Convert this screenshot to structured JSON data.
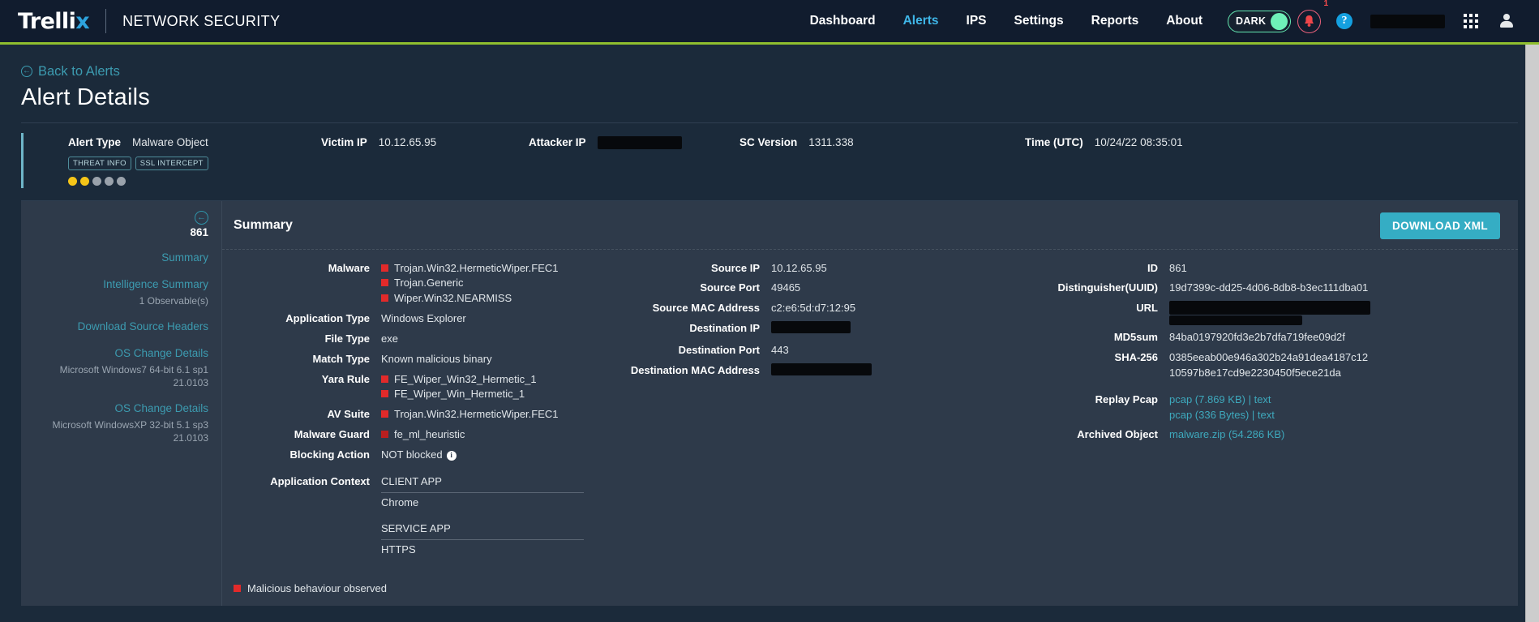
{
  "topnav": {
    "brand": "Trellix",
    "brand_sub": "NETWORK SECURITY",
    "links": [
      {
        "label": "Dashboard",
        "active": false
      },
      {
        "label": "Alerts",
        "active": true
      },
      {
        "label": "IPS",
        "active": false
      },
      {
        "label": "Settings",
        "active": false
      },
      {
        "label": "Reports",
        "active": false
      },
      {
        "label": "About",
        "active": false
      }
    ],
    "theme_toggle": "DARK",
    "notification_badge": "1",
    "help_glyph": "?",
    "accent_color": "#3fb6e8",
    "toggle_color": "#6ff0b8",
    "bar_color": "#8fbe2e"
  },
  "page": {
    "back_link": "Back to Alerts",
    "title": "Alert Details"
  },
  "meta": {
    "alert_type_label": "Alert Type",
    "alert_type_value": "Malware Object",
    "victim_ip_label": "Victim IP",
    "victim_ip_value": "10.12.65.95",
    "attacker_ip_label": "Attacker IP",
    "attacker_ip_value": "",
    "sc_version_label": "SC Version",
    "sc_version_value": "1311.338",
    "time_label": "Time (UTC)",
    "time_value": "10/24/22 08:35:01",
    "tags": [
      "THREAT INFO",
      "SSL INTERCEPT"
    ],
    "severity_filled": 2,
    "severity_total": 5
  },
  "sidebar": {
    "alert_id": "861",
    "items": [
      {
        "label": "Summary",
        "sub": ""
      },
      {
        "label": "Intelligence Summary",
        "sub": "1 Observable(s)"
      },
      {
        "label": "Download Source Headers",
        "sub": ""
      },
      {
        "label": "OS Change Details",
        "sub": "Microsoft Windows7 64-bit 6.1 sp1 21.0103"
      },
      {
        "label": "OS Change Details",
        "sub": "Microsoft WindowsXP 32-bit 5.1 sp3 21.0103"
      }
    ]
  },
  "summary": {
    "title": "Summary",
    "download_button": "DOWNLOAD XML"
  },
  "col1": {
    "malware_label": "Malware",
    "malware_values": [
      "Trojan.Win32.HermeticWiper.FEC1",
      "Trojan.Generic",
      "Wiper.Win32.NEARMISS"
    ],
    "application_type_label": "Application Type",
    "application_type_value": "Windows Explorer",
    "file_type_label": "File Type",
    "file_type_value": "exe",
    "match_type_label": "Match Type",
    "match_type_value": "Known malicious binary",
    "yara_rule_label": "Yara Rule",
    "yara_rule_values": [
      "FE_Wiper_Win32_Hermetic_1",
      "FE_Wiper_Win_Hermetic_1"
    ],
    "av_suite_label": "AV Suite",
    "av_suite_values": [
      "Trojan.Win32.HermeticWiper.FEC1"
    ],
    "malware_guard_label": "Malware Guard",
    "malware_guard_values": [
      "fe_ml_heuristic"
    ],
    "blocking_action_label": "Blocking Action",
    "blocking_action_value": "NOT blocked",
    "application_context_label": "Application Context",
    "client_app_header": "CLIENT APP",
    "client_app_value": "Chrome",
    "service_app_header": "SERVICE APP",
    "service_app_value": "HTTPS",
    "malicious_note": "Malicious behaviour observed"
  },
  "col2": {
    "source_ip_label": "Source IP",
    "source_ip_value": "10.12.65.95",
    "source_port_label": "Source Port",
    "source_port_value": "49465",
    "source_mac_label": "Source MAC Address",
    "source_mac_value": "c2:e6:5d:d7:12:95",
    "destination_ip_label": "Destination IP",
    "destination_ip_value": "",
    "destination_port_label": "Destination Port",
    "destination_port_value": "443",
    "destination_mac_label": "Destination MAC Address",
    "destination_mac_value": ""
  },
  "col3": {
    "id_label": "ID",
    "id_value": "861",
    "uuid_label": "Distinguisher(UUID)",
    "uuid_value": "19d7399c-dd25-4d06-8db8-b3ec111dba01",
    "url_label": "URL",
    "url_value": "",
    "md5_label": "MD5sum",
    "md5_value": "84ba0197920fd3e2b7dfa719fee09d2f",
    "sha256_label": "SHA-256",
    "sha256_value": "0385eeab00e946a302b24a91dea4187c1210597b8e17cd9e2230450f5ece21da",
    "replay_pcap_label": "Replay Pcap",
    "replay_pcap_1_file": "pcap (7.869 KB)",
    "replay_pcap_1_text": "text",
    "replay_pcap_2_file": "pcap (336 Bytes)",
    "replay_pcap_2_text": "text",
    "archived_object_label": "Archived Object",
    "archived_object_value": "malware.zip (54.286 KB)"
  }
}
